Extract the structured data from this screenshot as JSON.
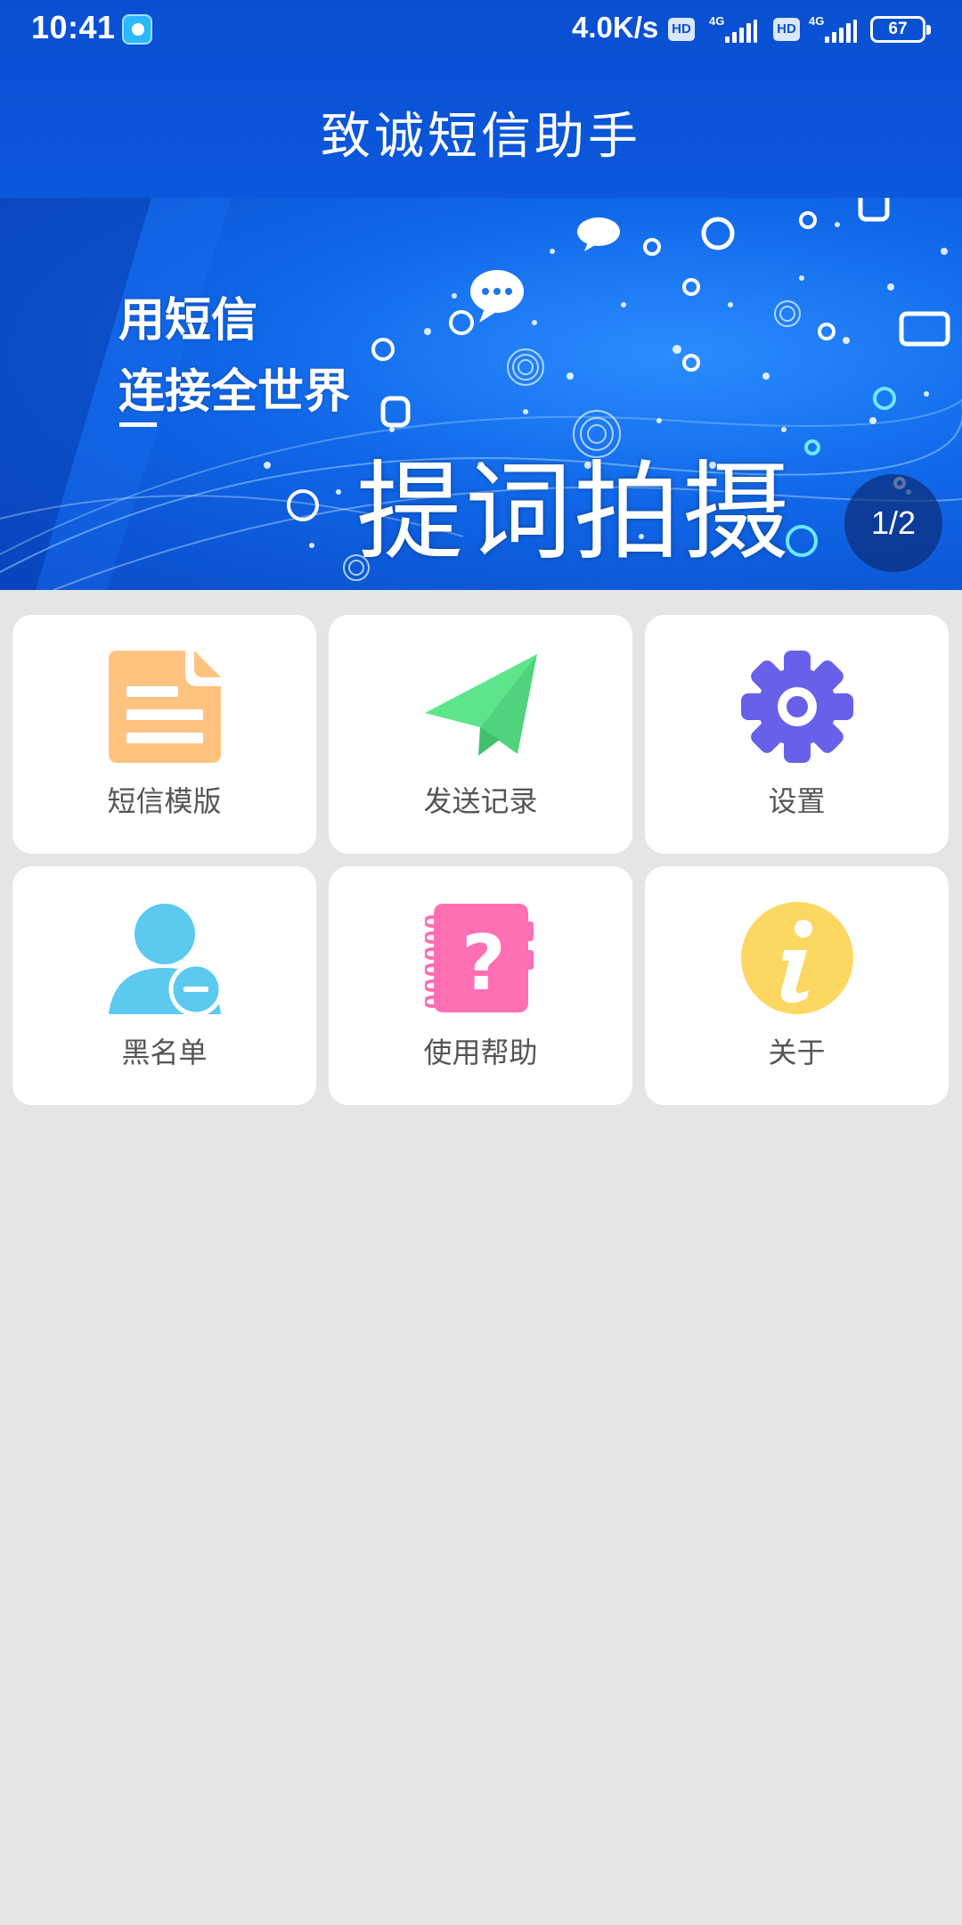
{
  "status_bar": {
    "time": "10:41",
    "net_speed": "4.0K/s",
    "hd_label": "HD",
    "network_type": "4G",
    "battery": "67"
  },
  "header": {
    "title": "致诚短信助手"
  },
  "banner": {
    "slogan_line1": "用短信",
    "slogan_line2": "连接全世界",
    "caption": "提词拍摄",
    "indicator": "1/2"
  },
  "menu": {
    "items": [
      {
        "label": "短信模版",
        "icon": "sms-template-icon",
        "color": "#ffc380"
      },
      {
        "label": "发送记录",
        "icon": "paper-plane-icon",
        "color": "#5ee58c"
      },
      {
        "label": "设置",
        "icon": "gear-icon",
        "color": "#6860e8"
      },
      {
        "label": "黑名单",
        "icon": "user-remove-icon",
        "color": "#5cc9ef"
      },
      {
        "label": "使用帮助",
        "icon": "help-book-icon",
        "color": "#ff6fb3"
      },
      {
        "label": "关于",
        "icon": "info-icon",
        "color": "#fcd863"
      }
    ]
  },
  "colors": {
    "appbar": "#0b52d6",
    "background": "#e5e5e5",
    "tile": "#ffffff",
    "label": "#555555"
  }
}
